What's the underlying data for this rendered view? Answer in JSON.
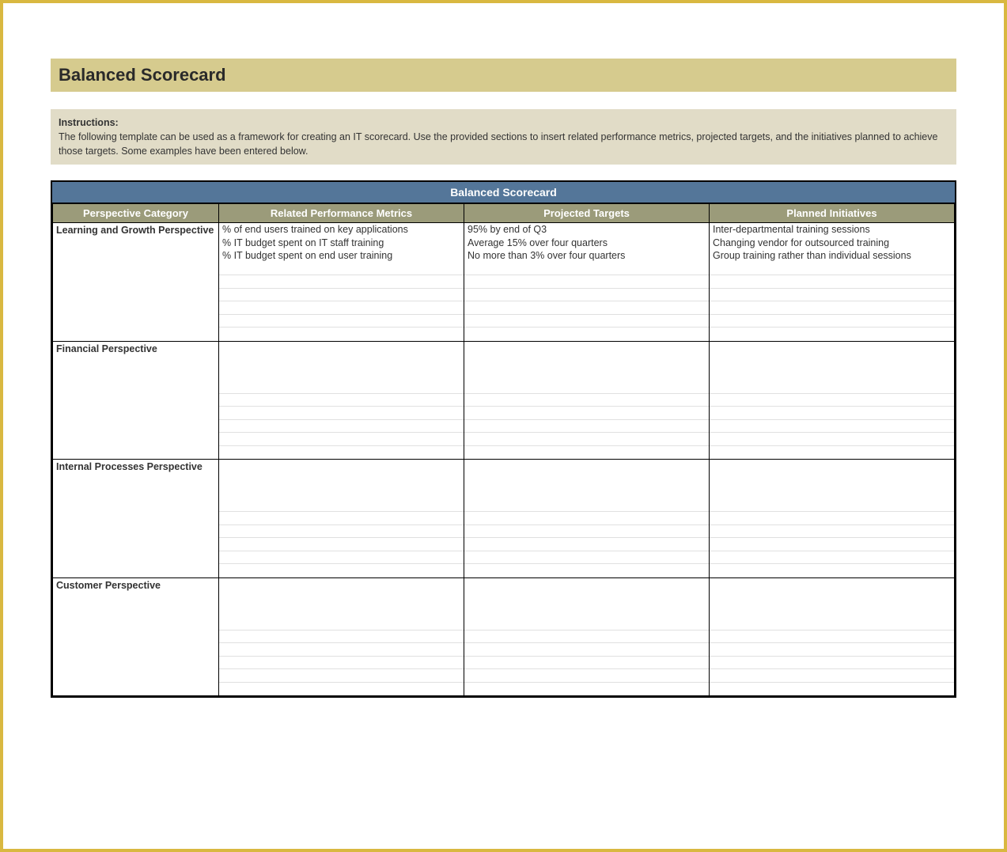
{
  "title": "Balanced Scorecard",
  "instructions": {
    "label": "Instructions:",
    "text": "The following template can be used as a framework for creating an IT scorecard. Use the provided sections to insert related performance metrics, projected targets, and the initiatives planned to achieve those targets. Some examples have been entered below."
  },
  "table": {
    "section_header": "Balanced Scorecard",
    "columns": [
      "Perspective Category",
      "Related Performance Metrics",
      "Projected Targets",
      "Planned Initiatives"
    ],
    "rows": [
      {
        "perspective": "Learning and Growth Perspective",
        "metrics": [
          "% of end users trained on key applications",
          "% IT budget spent on IT staff training",
          "% IT budget spent on end user training",
          "",
          "",
          "",
          "",
          "",
          ""
        ],
        "targets": [
          "95% by end of Q3",
          "Average 15% over four quarters",
          "No more than 3% over four quarters",
          "",
          "",
          "",
          "",
          "",
          ""
        ],
        "initiatives": [
          "Inter-departmental training sessions",
          "Changing vendor for outsourced training",
          "Group training rather than individual sessions",
          "",
          "",
          "",
          "",
          "",
          ""
        ]
      },
      {
        "perspective": "Financial Perspective",
        "metrics": [
          "",
          "",
          "",
          "",
          "",
          "",
          "",
          "",
          ""
        ],
        "targets": [
          "",
          "",
          "",
          "",
          "",
          "",
          "",
          "",
          ""
        ],
        "initiatives": [
          "",
          "",
          "",
          "",
          "",
          "",
          "",
          "",
          ""
        ]
      },
      {
        "perspective": "Internal Processes Perspective",
        "metrics": [
          "",
          "",
          "",
          "",
          "",
          "",
          "",
          "",
          ""
        ],
        "targets": [
          "",
          "",
          "",
          "",
          "",
          "",
          "",
          "",
          ""
        ],
        "initiatives": [
          "",
          "",
          "",
          "",
          "",
          "",
          "",
          "",
          ""
        ]
      },
      {
        "perspective": "Customer Perspective",
        "metrics": [
          "",
          "",
          "",
          "",
          "",
          "",
          "",
          "",
          ""
        ],
        "targets": [
          "",
          "",
          "",
          "",
          "",
          "",
          "",
          "",
          ""
        ],
        "initiatives": [
          "",
          "",
          "",
          "",
          "",
          "",
          "",
          "",
          ""
        ]
      }
    ]
  }
}
